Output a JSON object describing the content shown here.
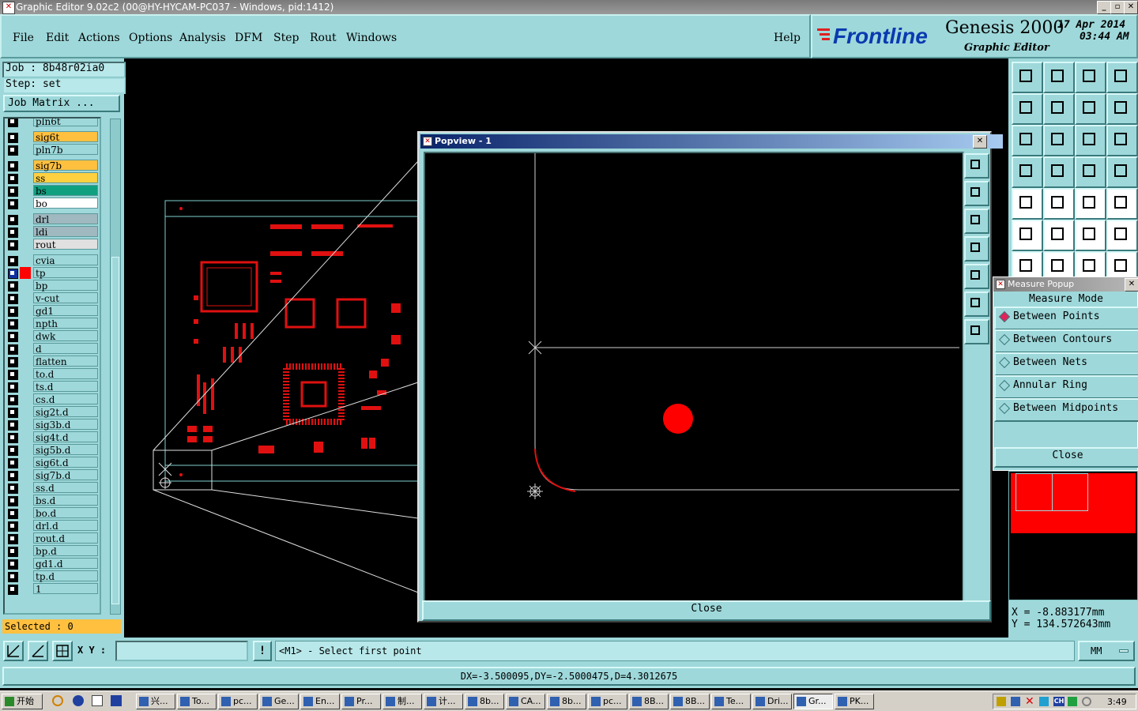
{
  "window": {
    "title": "Graphic Editor 9.02c2 (00@HY-HYCAM-PC037 - Windows, pid:1412)"
  },
  "menu": [
    "File",
    "Edit",
    "Actions",
    "Options",
    "Analysis",
    "DFM",
    "Step",
    "Rout",
    "Windows"
  ],
  "help_label": "Help",
  "brand": {
    "logo": "Frontline",
    "product": "Genesis 2000",
    "subtitle": "Graphic Editor",
    "date": "17 Apr 2014",
    "time": "03:44 AM"
  },
  "job": {
    "job_label": "Job : 8b48r02ia0",
    "step_label": "Step: set",
    "matrix_button": "Job Matrix ..."
  },
  "layers": [
    {
      "name": "pln6t",
      "color": "#9ed8da"
    },
    {
      "name": "sig6t",
      "color": "#ffc040"
    },
    {
      "name": "pln7b",
      "color": "#9ed8da"
    },
    {
      "name": "sig7b",
      "color": "#ffc040"
    },
    {
      "name": "ss",
      "color": "#ffd040"
    },
    {
      "name": "bs",
      "color": "#10a080"
    },
    {
      "name": "bo",
      "color": "#ffffff"
    },
    {
      "name": "drl",
      "color": "#a0b8c0"
    },
    {
      "name": "ldi",
      "color": "#a0b8c0"
    },
    {
      "name": "rout",
      "color": "#e0e0e0"
    },
    {
      "name": "cvia",
      "color": "#9ed8da"
    },
    {
      "name": "tp",
      "color": "#9ed8da"
    },
    {
      "name": "bp",
      "color": "#9ed8da"
    },
    {
      "name": "v-cut",
      "color": "#9ed8da"
    },
    {
      "name": "gd1",
      "color": "#9ed8da"
    },
    {
      "name": "npth",
      "color": "#9ed8da"
    },
    {
      "name": "dwk",
      "color": "#9ed8da"
    },
    {
      "name": "d",
      "color": "#9ed8da"
    },
    {
      "name": "flatten",
      "color": "#9ed8da"
    },
    {
      "name": "to.d",
      "color": "#9ed8da"
    },
    {
      "name": "ts.d",
      "color": "#9ed8da"
    },
    {
      "name": "cs.d",
      "color": "#9ed8da"
    },
    {
      "name": "sig2t.d",
      "color": "#9ed8da"
    },
    {
      "name": "sig3b.d",
      "color": "#9ed8da"
    },
    {
      "name": "sig4t.d",
      "color": "#9ed8da"
    },
    {
      "name": "sig5b.d",
      "color": "#9ed8da"
    },
    {
      "name": "sig6t.d",
      "color": "#9ed8da"
    },
    {
      "name": "sig7b.d",
      "color": "#9ed8da"
    },
    {
      "name": "ss.d",
      "color": "#9ed8da"
    },
    {
      "name": "bs.d",
      "color": "#9ed8da"
    },
    {
      "name": "bo.d",
      "color": "#9ed8da"
    },
    {
      "name": "drl.d",
      "color": "#9ed8da"
    },
    {
      "name": "rout.d",
      "color": "#9ed8da"
    },
    {
      "name": "bp.d",
      "color": "#9ed8da"
    },
    {
      "name": "gd1.d",
      "color": "#9ed8da"
    },
    {
      "name": "tp.d",
      "color": "#9ed8da"
    },
    {
      "name": "1",
      "color": "#9ed8da"
    }
  ],
  "selected_label": "Selected : 0",
  "popview": {
    "title": "Popview - 1",
    "close_label": "Close"
  },
  "measure": {
    "title": "Measure Popup",
    "mode_label": "Measure Mode",
    "options": [
      "Between Points",
      "Between Contours",
      "Between Nets",
      "Annular Ring",
      "Between Midpoints"
    ],
    "selected_option": "Between Points",
    "close_label": "Close"
  },
  "coords": {
    "x": "X = -8.883177mm",
    "y": "Y = 134.572643mm"
  },
  "input": {
    "xy_label": "X Y :",
    "value": "",
    "prompt": "<M1> - Select first point",
    "units": "MM"
  },
  "status": {
    "measure_result": "DX=-3.500095,DY=-2.5000475,D=4.3012675"
  },
  "taskbar": {
    "start_label": "开始",
    "clock": "3:49",
    "tasks": [
      "兴...",
      "To...",
      "pc...",
      "Ge...",
      "En...",
      "Pr...",
      "制...",
      "计...",
      "8b...",
      "CA...",
      "8b...",
      "pc...",
      "8B...",
      "8B...",
      "Te...",
      "Dri...",
      "Gr...",
      "PK..."
    ],
    "active_task": "Gr..."
  }
}
